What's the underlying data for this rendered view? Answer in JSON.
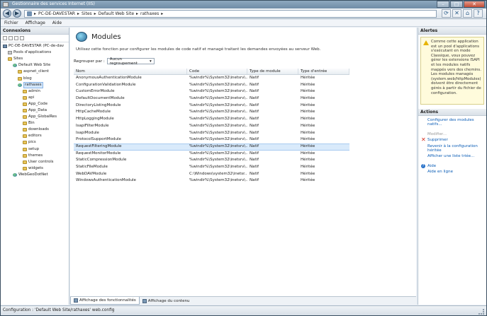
{
  "window": {
    "title": "Gestionnaire des services Internet (IIS)"
  },
  "navbar": {
    "breadcrumb": [
      "PC-DE-DAVESTAR",
      "Sites",
      "Default Web Site",
      "rathaxes"
    ]
  },
  "menu": [
    "Fichier",
    "Affichage",
    "Aide"
  ],
  "connections": {
    "header": "Connexions",
    "tree": [
      {
        "label": "PC-DE-DAVESTAR (PC-de-dav",
        "indent": 0,
        "icon": "pc"
      },
      {
        "label": "Pools d'applications",
        "indent": 1,
        "icon": "pool"
      },
      {
        "label": "Sites",
        "indent": 1,
        "icon": "folder"
      },
      {
        "label": "Default Web Site",
        "indent": 2,
        "icon": "globe"
      },
      {
        "label": "aspnet_client",
        "indent": 3,
        "icon": "folder"
      },
      {
        "label": "blog",
        "indent": 3,
        "icon": "folder"
      },
      {
        "label": "rathaxes",
        "indent": 3,
        "icon": "globe",
        "selected": true
      },
      {
        "label": "admin",
        "indent": 4,
        "icon": "folder"
      },
      {
        "label": "api",
        "indent": 4,
        "icon": "folder"
      },
      {
        "label": "App_Code",
        "indent": 4,
        "icon": "folder"
      },
      {
        "label": "App_Data",
        "indent": 4,
        "icon": "folder"
      },
      {
        "label": "App_GlobalRes",
        "indent": 4,
        "icon": "folder"
      },
      {
        "label": "Bin",
        "indent": 4,
        "icon": "folder"
      },
      {
        "label": "downloads",
        "indent": 4,
        "icon": "folder"
      },
      {
        "label": "editors",
        "indent": 4,
        "icon": "folder"
      },
      {
        "label": "pics",
        "indent": 4,
        "icon": "folder"
      },
      {
        "label": "setup",
        "indent": 4,
        "icon": "folder"
      },
      {
        "label": "themes",
        "indent": 4,
        "icon": "folder"
      },
      {
        "label": "User controls",
        "indent": 4,
        "icon": "folder"
      },
      {
        "label": "widgets",
        "indent": 4,
        "icon": "folder"
      },
      {
        "label": "WebGeoDotNet",
        "indent": 2,
        "icon": "globe"
      }
    ]
  },
  "main": {
    "title": "Modules",
    "description": "Utilisez cette fonction pour configurer les modules de code natif et managé traitant les demandes envoyées au serveur Web.",
    "group_label": "Regrouper par :",
    "group_value": "Aucun regroupement",
    "columns": [
      "Nom",
      "Code",
      "Type de module",
      "Type d'entrée"
    ],
    "rows": [
      [
        "AnonymousAuthenticationModule",
        "%windir%\\System32\\inetsrv\\...",
        "Natif",
        "Héritée"
      ],
      [
        "ConfigurationValidationModule",
        "%windir%\\System32\\inetsrv\\...",
        "Natif",
        "Héritée"
      ],
      [
        "CustomErrorModule",
        "%windir%\\System32\\inetsrv\\...",
        "Natif",
        "Héritée"
      ],
      [
        "DefaultDocumentModule",
        "%windir%\\System32\\inetsrv\\...",
        "Natif",
        "Héritée"
      ],
      [
        "DirectoryListingModule",
        "%windir%\\System32\\inetsrv\\...",
        "Natif",
        "Héritée"
      ],
      [
        "HttpCacheModule",
        "%windir%\\System32\\inetsrv\\...",
        "Natif",
        "Héritée"
      ],
      [
        "HttpLoggingModule",
        "%windir%\\System32\\inetsrv\\...",
        "Natif",
        "Héritée"
      ],
      [
        "IsapiFilterModule",
        "%windir%\\System32\\inetsrv\\...",
        "Natif",
        "Héritée"
      ],
      [
        "IsapiModule",
        "%windir%\\System32\\inetsrv\\...",
        "Natif",
        "Héritée"
      ],
      [
        "ProtocolSupportModule",
        "%windir%\\System32\\inetsrv\\...",
        "Natif",
        "Héritée"
      ],
      [
        "RequestFilteringModule",
        "%windir%\\System32\\inetsrv\\...",
        "Natif",
        "Héritée"
      ],
      [
        "RequestMonitorModule",
        "%windir%\\System32\\inetsrv\\...",
        "Natif",
        "Héritée"
      ],
      [
        "StaticCompressionModule",
        "%windir%\\System32\\inetsrv\\...",
        "Natif",
        "Héritée"
      ],
      [
        "StaticFileModule",
        "%windir%\\System32\\inetsrv\\...",
        "Natif",
        "Héritée"
      ],
      [
        "WebDAVModule",
        "C:\\Windows\\system32\\inetsr...",
        "Natif",
        "Héritée"
      ],
      [
        "WindowsAuthenticationModule",
        "%windir%\\System32\\inetsrv\\...",
        "Natif",
        "Héritée"
      ]
    ],
    "selected_row": 10
  },
  "bottom_tabs": {
    "features": "Affichage des fonctionnalités",
    "content": "Affichage du contenu"
  },
  "alerts": {
    "header": "Alertes",
    "text": "Comme cette application est un pool d'applications s'exécutant en mode Classique, vous pouvez gérer les extensions ISAPI et les modules natifs mappés vers des chemins. Les modules managés (system.web/httpModules) doivent être directement gérés à partir du fichier de configuration."
  },
  "actions": {
    "header": "Actions",
    "configure_native": "Configurer des modules natifs...",
    "modify": "Modifier...",
    "delete": "Supprimer",
    "revert": "Revenir à la configuration héritée",
    "ordered_list": "Afficher une liste triée...",
    "help": "Aide",
    "online_help": "Aide en ligne"
  },
  "status": {
    "text": "Configuration : 'Default Web Site/rathaxes' web.config"
  }
}
